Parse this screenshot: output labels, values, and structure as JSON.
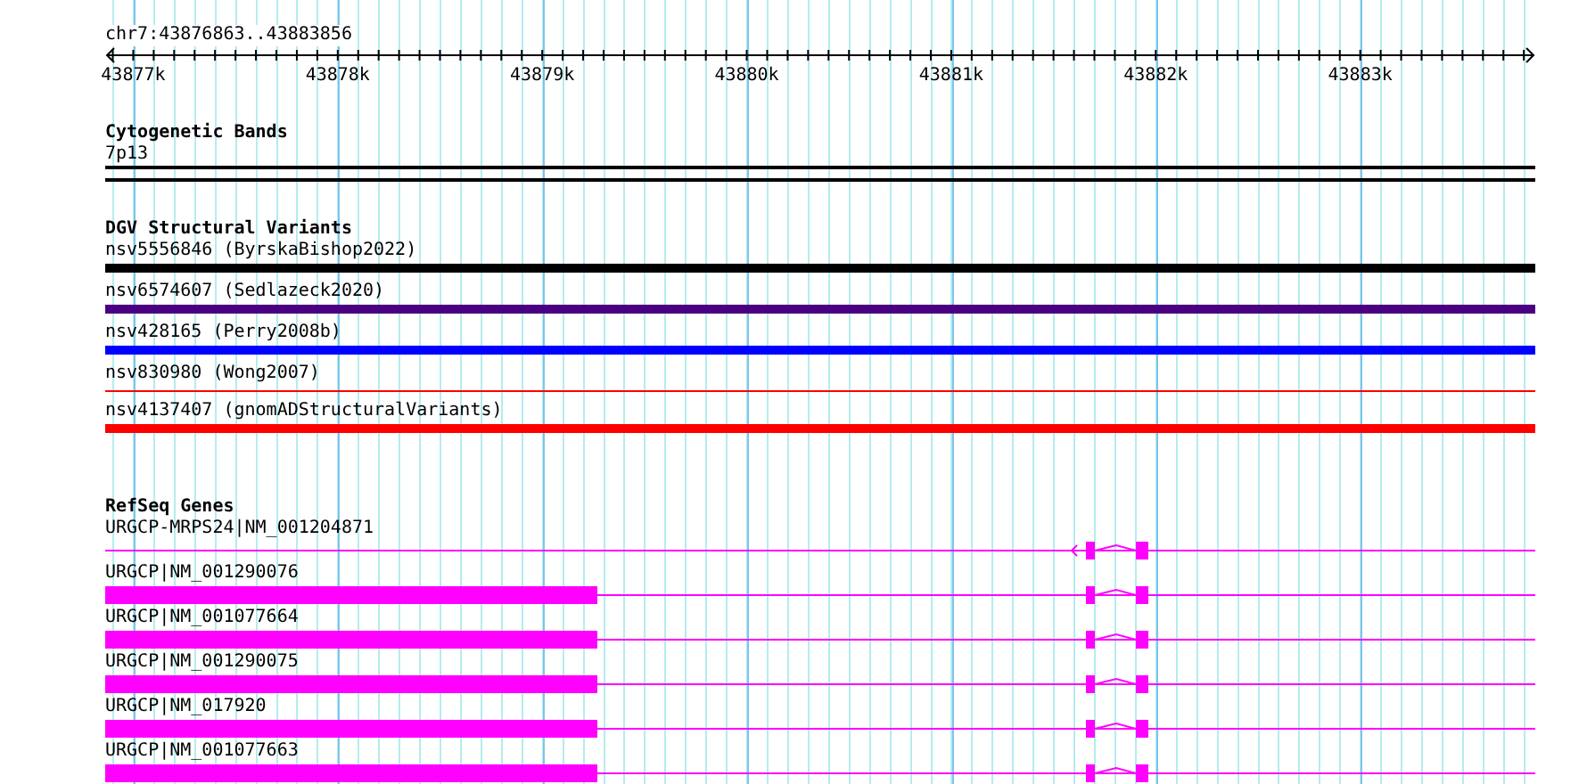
{
  "ruler": {
    "location": "chr7:43876863..43883856",
    "tick_labels": [
      "43877k",
      "43878k",
      "43879k",
      "43880k",
      "43881k",
      "43882k",
      "43883k"
    ]
  },
  "tracks": [
    {
      "kind": "bands",
      "title": "Cytogenetic Bands",
      "features": [
        {
          "label": "7p13"
        }
      ]
    },
    {
      "kind": "variants",
      "title": "DGV Structural Variants",
      "features": [
        {
          "label": "nsv5556846 (ByrskaBishop2022)",
          "kind": "bar",
          "color": "#000000"
        },
        {
          "label": "nsv6574607 (Sedlazeck2020)",
          "kind": "bar",
          "color": "#4b0082"
        },
        {
          "label": "nsv428165 (Perry2008b)",
          "kind": "bar",
          "color": "#0000ff"
        },
        {
          "label": "nsv830980 (Wong2007)",
          "kind": "line",
          "color": "#ff0000"
        },
        {
          "label": "nsv4137407 (gnomADStructuralVariants)",
          "kind": "bar",
          "color": "#ff0000"
        }
      ]
    },
    {
      "kind": "genes",
      "title": "RefSeq Genes",
      "features": [
        {
          "label": "URGCP-MRPS24|NM_001204871",
          "leading_block": false,
          "strand_arrow": true
        },
        {
          "label": "URGCP|NM_001290076",
          "leading_block": true,
          "strand_arrow": false
        },
        {
          "label": "URGCP|NM_001077664",
          "leading_block": true,
          "strand_arrow": false
        },
        {
          "label": "URGCP|NM_001290075",
          "leading_block": true,
          "strand_arrow": false
        },
        {
          "label": "URGCP|NM_017920",
          "leading_block": true,
          "strand_arrow": false
        },
        {
          "label": "URGCP|NM_001077663",
          "leading_block": true,
          "strand_arrow": false
        }
      ]
    }
  ]
}
